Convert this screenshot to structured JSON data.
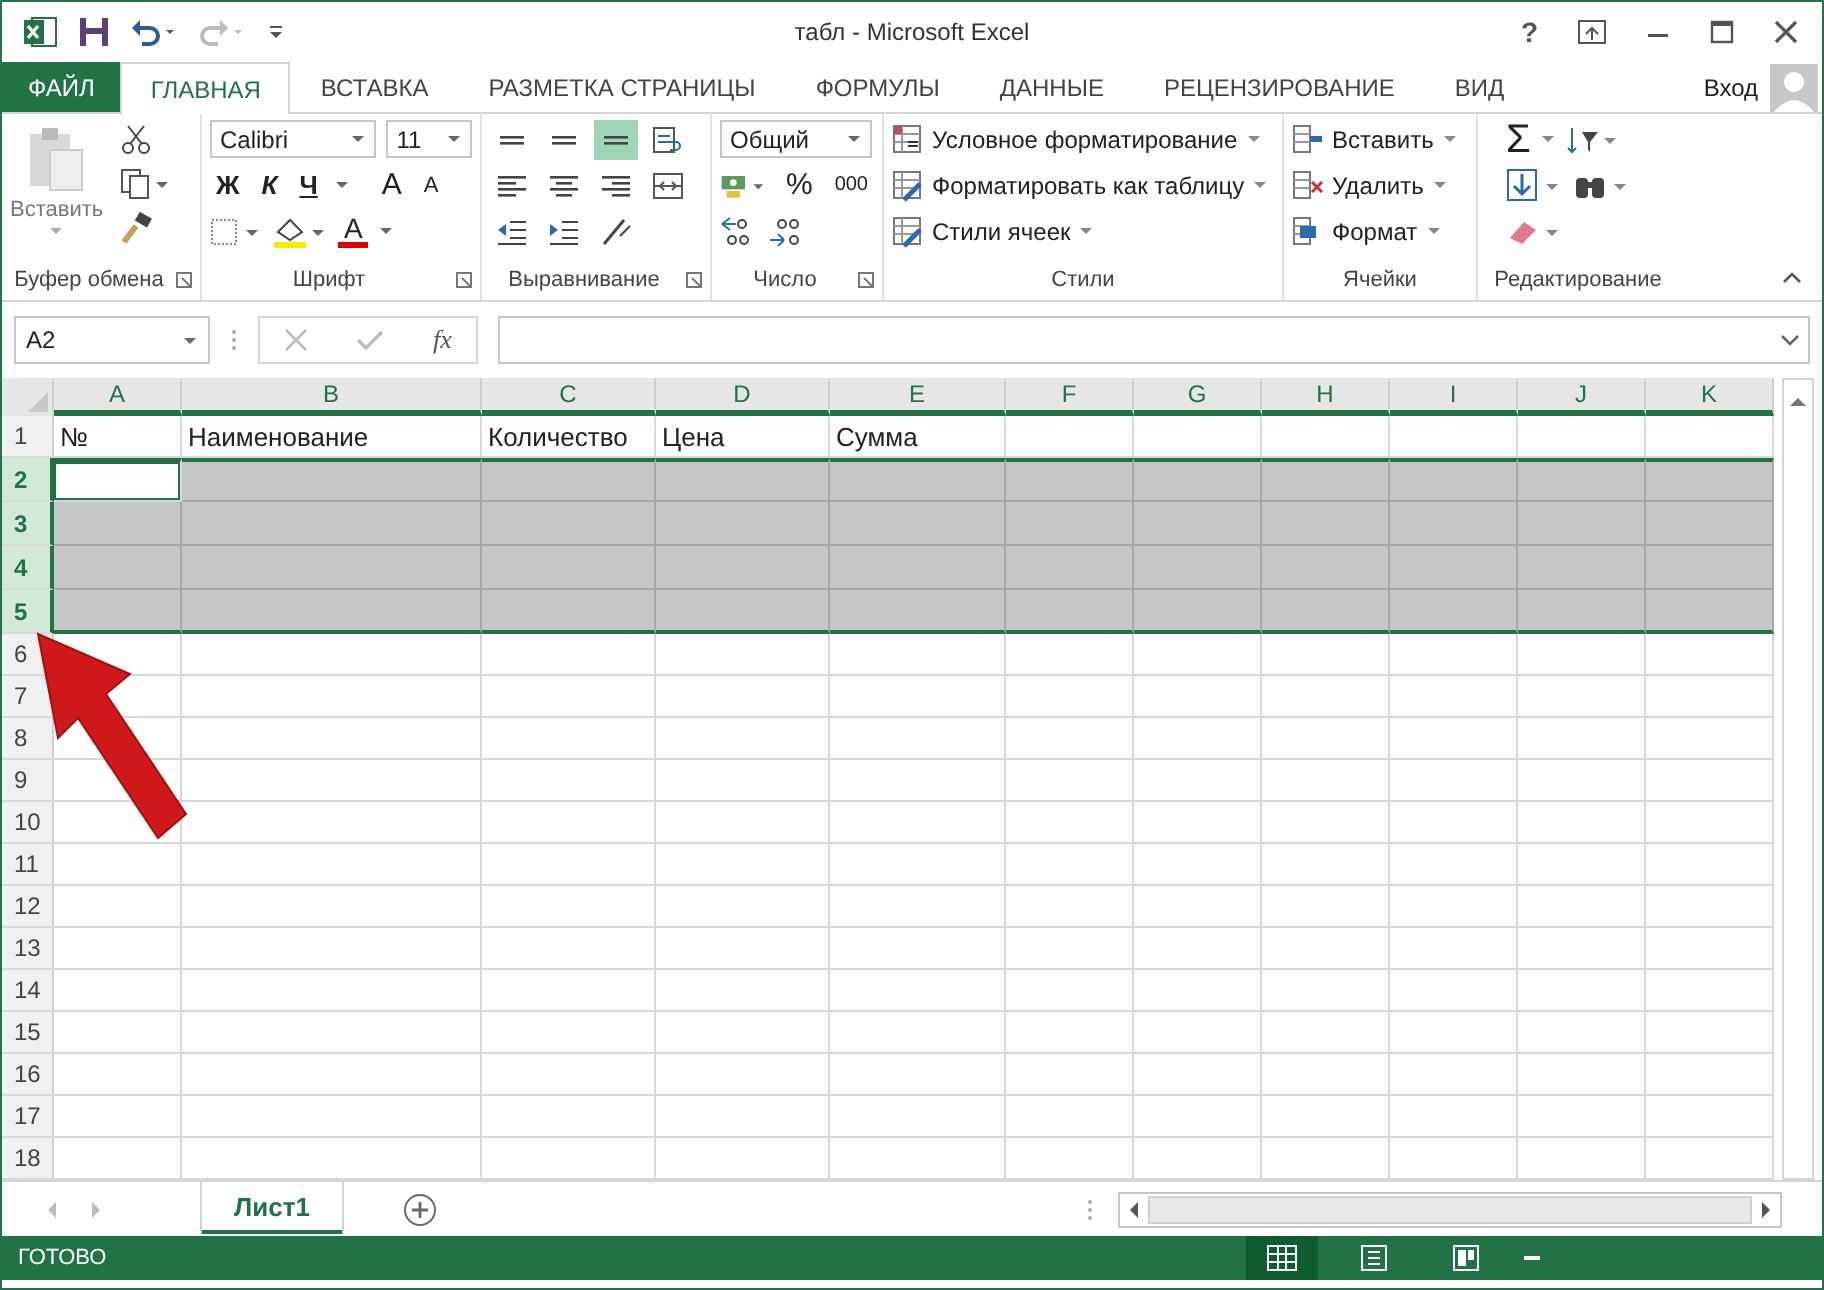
{
  "window": {
    "title": "табл - Microsoft Excel",
    "help": "?",
    "user": "Вход"
  },
  "tabs": [
    {
      "label": "ФАЙЛ",
      "kind": "file",
      "selected": false
    },
    {
      "label": "ГЛАВНАЯ",
      "kind": "tab",
      "selected": true
    },
    {
      "label": "ВСТАВКА",
      "kind": "tab",
      "selected": false
    },
    {
      "label": "РАЗМЕТКА СТРАНИЦЫ",
      "kind": "tab",
      "selected": false
    },
    {
      "label": "ФОРМУЛЫ",
      "kind": "tab",
      "selected": false
    },
    {
      "label": "ДАННЫЕ",
      "kind": "tab",
      "selected": false
    },
    {
      "label": "РЕЦЕНЗИРОВАНИЕ",
      "kind": "tab",
      "selected": false
    },
    {
      "label": "ВИД",
      "kind": "tab",
      "selected": false
    }
  ],
  "ribbon": {
    "clipboard": {
      "label": "Буфер обмена",
      "paste": "Вставить"
    },
    "font": {
      "label": "Шрифт",
      "name": "Calibri",
      "size": "11",
      "bold": "Ж",
      "italic": "К",
      "underline": "Ч",
      "grow": "A",
      "shrink": "A",
      "font_color_label": "A"
    },
    "alignment": {
      "label": "Выравнивание",
      "buttons": [
        {
          "kind": "top",
          "selected": false
        },
        {
          "kind": "middle",
          "selected": false
        },
        {
          "kind": "bottom",
          "selected": true
        },
        {
          "kind": "wrap",
          "selected": false
        },
        {
          "kind": "left",
          "selected": false
        },
        {
          "kind": "center",
          "selected": false
        },
        {
          "kind": "right",
          "selected": false
        },
        {
          "kind": "merge",
          "selected": false
        },
        {
          "kind": "outdent",
          "selected": false
        },
        {
          "kind": "indent",
          "selected": false
        },
        {
          "kind": "orientation",
          "selected": false
        }
      ]
    },
    "number": {
      "label": "Число",
      "format": "Общий",
      "percent": "%",
      "thousands": "000"
    },
    "styles": {
      "label": "Стили",
      "items": [
        {
          "label": "Условное форматирование",
          "kind": "conditional"
        },
        {
          "label": "Форматировать как таблицу",
          "kind": "table"
        },
        {
          "label": "Стили ячеек",
          "kind": "cellstyle"
        }
      ]
    },
    "cells": {
      "label": "Ячейки",
      "items": [
        {
          "label": "Вставить",
          "kind": "insert"
        },
        {
          "label": "Удалить",
          "kind": "delete"
        },
        {
          "label": "Формат",
          "kind": "format"
        }
      ]
    },
    "editing": {
      "label": "Редактирование",
      "sum": "Σ"
    }
  },
  "formula_bar": {
    "name_box": "A2",
    "fx": "fx"
  },
  "grid": {
    "columns": [
      "A",
      "B",
      "C",
      "D",
      "E",
      "F",
      "G",
      "H",
      "I",
      "J",
      "K"
    ],
    "rows": [
      {
        "number": "1",
        "selected": false,
        "active": false,
        "cells": [
          "№",
          "Наименование",
          "Количество",
          "Цена",
          "Сумма"
        ]
      },
      {
        "number": "2",
        "selected": true,
        "active": true
      },
      {
        "number": "3",
        "selected": true,
        "active": false
      },
      {
        "number": "4",
        "selected": true,
        "active": false
      },
      {
        "number": "5",
        "selected": true,
        "active": false
      },
      {
        "number": "6",
        "selected": false,
        "active": false
      },
      {
        "number": "7",
        "selected": false,
        "active": false
      },
      {
        "number": "8",
        "selected": false,
        "active": false
      },
      {
        "number": "9",
        "selected": false,
        "active": false
      },
      {
        "number": "10",
        "selected": false,
        "active": false
      },
      {
        "number": "11",
        "selected": false,
        "active": false
      },
      {
        "number": "12",
        "selected": false,
        "active": false
      },
      {
        "number": "13",
        "selected": false,
        "active": false
      },
      {
        "number": "14",
        "selected": false,
        "active": false
      },
      {
        "number": "15",
        "selected": false,
        "active": false
      },
      {
        "number": "16",
        "selected": false,
        "active": false
      },
      {
        "number": "17",
        "selected": false,
        "active": false
      },
      {
        "number": "18",
        "selected": false,
        "active": false
      }
    ]
  },
  "sheets": [
    {
      "label": "Лист1",
      "selected": true
    }
  ],
  "status_bar": {
    "text": "ГОТОВО",
    "views": [
      {
        "kind": "normal",
        "selected": true
      },
      {
        "kind": "layout",
        "selected": false
      },
      {
        "kind": "break",
        "selected": false
      }
    ]
  }
}
